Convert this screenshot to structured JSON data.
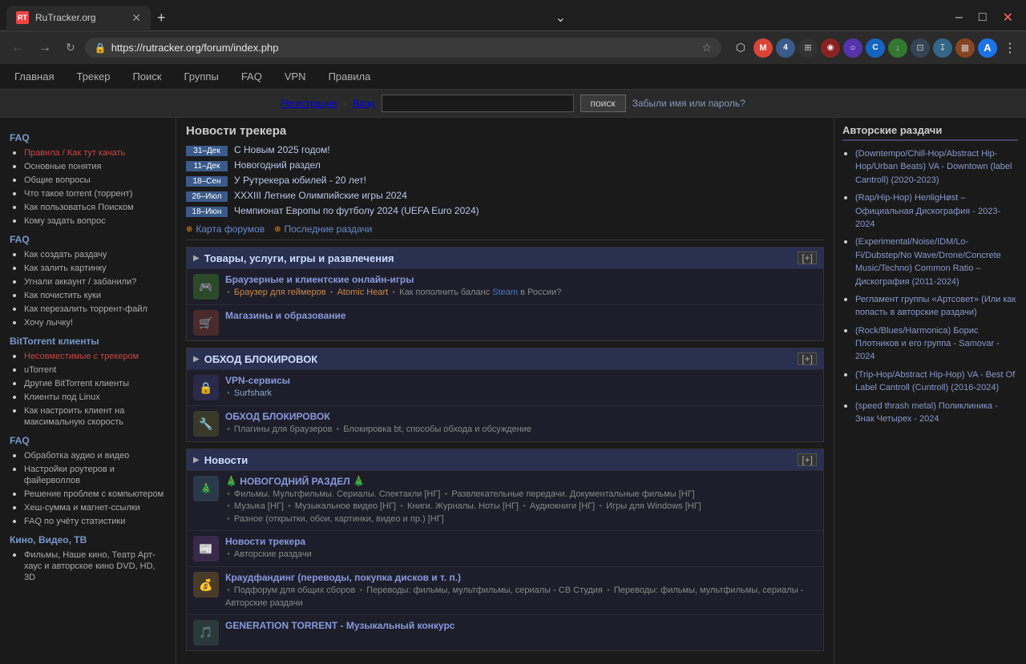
{
  "browser": {
    "tab_title": "RuTracker.org",
    "tab_favicon": "RT",
    "url": "https://rutracker.org/forum/index.php",
    "window_controls": {
      "minimize": "–",
      "maximize": "□",
      "close": "✕"
    }
  },
  "site_nav": {
    "items": [
      {
        "label": "Главная",
        "href": "#"
      },
      {
        "label": "Трекер",
        "href": "#"
      },
      {
        "label": "Поиск",
        "href": "#"
      },
      {
        "label": "Группы",
        "href": "#"
      },
      {
        "label": "FAQ",
        "href": "#"
      },
      {
        "label": "VPN",
        "href": "#"
      },
      {
        "label": "Правила",
        "href": "#"
      }
    ]
  },
  "search_bar": {
    "register_label": "Регистрация",
    "login_label": "Вход",
    "separator": "·",
    "search_placeholder": "",
    "search_btn": "поиск",
    "forgot_label": "Забыли имя или пароль?"
  },
  "sidebar": {
    "sections": [
      {
        "title": "FAQ",
        "items": [
          {
            "label": "Правила / Как тут качать",
            "href": "#",
            "class": "red-link"
          },
          {
            "label": "Основные понятия",
            "href": "#"
          },
          {
            "label": "Общие вопросы",
            "href": "#"
          },
          {
            "label": "Что такое torrent (торрент)",
            "href": "#"
          },
          {
            "label": "Как пользоваться Поиском",
            "href": "#"
          },
          {
            "label": "Кому задать вопрос",
            "href": "#"
          }
        ]
      },
      {
        "title": "FAQ",
        "items": [
          {
            "label": "Как создать раздачу",
            "href": "#"
          },
          {
            "label": "Как залить картинку",
            "href": "#"
          },
          {
            "label": "Угнали аккаунт / забанили?",
            "href": "#"
          },
          {
            "label": "Как почистить куки",
            "href": "#"
          },
          {
            "label": "Как перезалить торрент-файл",
            "href": "#"
          },
          {
            "label": "Хочу лычку!",
            "href": "#"
          }
        ]
      },
      {
        "title": "BitTorrent клиенты",
        "items": [
          {
            "label": "Несовместимые с трекером",
            "href": "#",
            "class": "red-link"
          },
          {
            "label": "uTorrent",
            "href": "#"
          },
          {
            "label": "Другие BitTorrent клиенты",
            "href": "#"
          },
          {
            "label": "Клиенты под Linux",
            "href": "#"
          },
          {
            "label": "Как настроить клиент на максимальную скорость",
            "href": "#"
          }
        ]
      },
      {
        "title": "FAQ",
        "items": [
          {
            "label": "Обработка аудио и видео",
            "href": "#"
          },
          {
            "label": "Настройки роутеров и файерволлов",
            "href": "#"
          },
          {
            "label": "Решение проблем с компьютером",
            "href": "#"
          },
          {
            "label": "Хеш-сумма и магнет-ссылки",
            "href": "#"
          },
          {
            "label": "FAQ по учёту статистики",
            "href": "#"
          }
        ]
      },
      {
        "title": "Кино, Видео, ТВ",
        "items": [
          {
            "label": "Фильмы, Наше кино, Театр Арт-хаус и авторское кино DVD, HD, 3D",
            "href": "#"
          }
        ]
      }
    ]
  },
  "news_section": {
    "title": "Новости трекера",
    "items": [
      {
        "date": "31–Дек",
        "text": "С Новым 2025 годом!"
      },
      {
        "date": "11–Дек",
        "text": "Новогодний раздел"
      },
      {
        "date": "18–Сен",
        "text": "У Рутрекера юбилей - 20 лет!"
      },
      {
        "date": "26–Июл",
        "text": "XXXIII Летние Олимпийские игры 2024"
      },
      {
        "date": "18–Июн",
        "text": "Чемпионат Европы по футболу 2024 (UEFA Euro 2024)"
      }
    ]
  },
  "forum_links": {
    "map_label": "Карта форумов",
    "recent_label": "Последние раздачи"
  },
  "categories": [
    {
      "title": "Товары, услуги, игры и развлечения",
      "id": "cat1",
      "subcategories": [
        {
          "icon_type": "games",
          "icon_glyph": "🎮",
          "title": "Браузерные и клиентские онлайн-игры",
          "desc": "Браузер для геймеров",
          "desc2": "Atomic Heart",
          "desc3": "Как пополнить баланс",
          "desc4": "Steam",
          "desc5": "в России?"
        },
        {
          "icon_type": "shop",
          "icon_glyph": "🛒",
          "title": "Магазины и образование",
          "desc": ""
        }
      ]
    },
    {
      "title": "ОБХОД БЛОКИРОВОК",
      "id": "cat2",
      "subcategories": [
        {
          "icon_type": "vpn",
          "icon_glyph": "🔒",
          "title": "VPN-сервисы",
          "desc": "Surfshark"
        },
        {
          "icon_type": "block",
          "icon_glyph": "🔧",
          "title": "ОБХОД БЛОКИРОВОК",
          "desc": "Плагины для браузеров • Блокировка bt, способы обхода и обсуждение"
        }
      ]
    },
    {
      "title": "Новости",
      "id": "cat3",
      "subcategories": [
        {
          "icon_type": "news",
          "icon_glyph": "🎄",
          "title": "НОВОГОДНИЙ РАЗДЕЛ 🎄",
          "desc": "Фильмы. Мультфильмы. Сериалы. Спектакли [НГ] • Развлекательные передачи. Документальные фильмы [НГ] • Музыка [НГ] • Музыкальное видео [НГ] • Книги. Журналы. Ноты [НГ] • Аудиокниги [НГ] • Игры для Windows [НГ] • Разное (открытки, обои, картинки, видео и пр.) [НГ]"
        },
        {
          "icon_type": "news2",
          "icon_glyph": "📰",
          "title": "Новости трекера",
          "desc": "Авторские раздачи"
        },
        {
          "icon_type": "crowd",
          "icon_glyph": "💰",
          "title": "Краудфандинг (переводы, покупка дисков и т. п.)",
          "desc": "Подфорум для общих сборов • Переводы: фильмы, мультфильмы, сериалы - СВ Студия • Переводы: фильмы, мультфильмы, сериалы - Авторские раздачи"
        },
        {
          "icon_type": "news3",
          "icon_glyph": "🎵",
          "title": "GENERATION TORRENT - Музыкальный конкурс",
          "desc": ""
        }
      ]
    }
  ],
  "right_sidebar": {
    "title": "Авторские раздачи",
    "items": [
      {
        "text": "(Downtempo/Chill-Hop/Abstract Hip-Hop/Urban Beats) VA - Downtown (label Cantroll) (2020-2023)"
      },
      {
        "text": "(Rap/Hip-Hop) HелligНøst – Официальная Дискография - 2023-2024"
      },
      {
        "text": "(Experimental/Noise/IDM/Lo-Fi/Dubstep/No Wave/Drone/Concrete Music/Techno) Common Ratio – Дискография (2011-2024)"
      },
      {
        "text": "Регламент группы «Артсовет» (Или как попасть в авторские раздачи)"
      },
      {
        "text": "(Rock/Blues/Harmonica) Борис Плотников и его группа - Samovar - 2024"
      },
      {
        "text": "(Trip-Hop/Abstract Hip-Hop) VA - Best Of Label Cantroll (Cuntroll) (2016-2024)"
      },
      {
        "text": "(speed thrash metal) Поликлиника - Знак Четырех - 2024"
      }
    ]
  }
}
